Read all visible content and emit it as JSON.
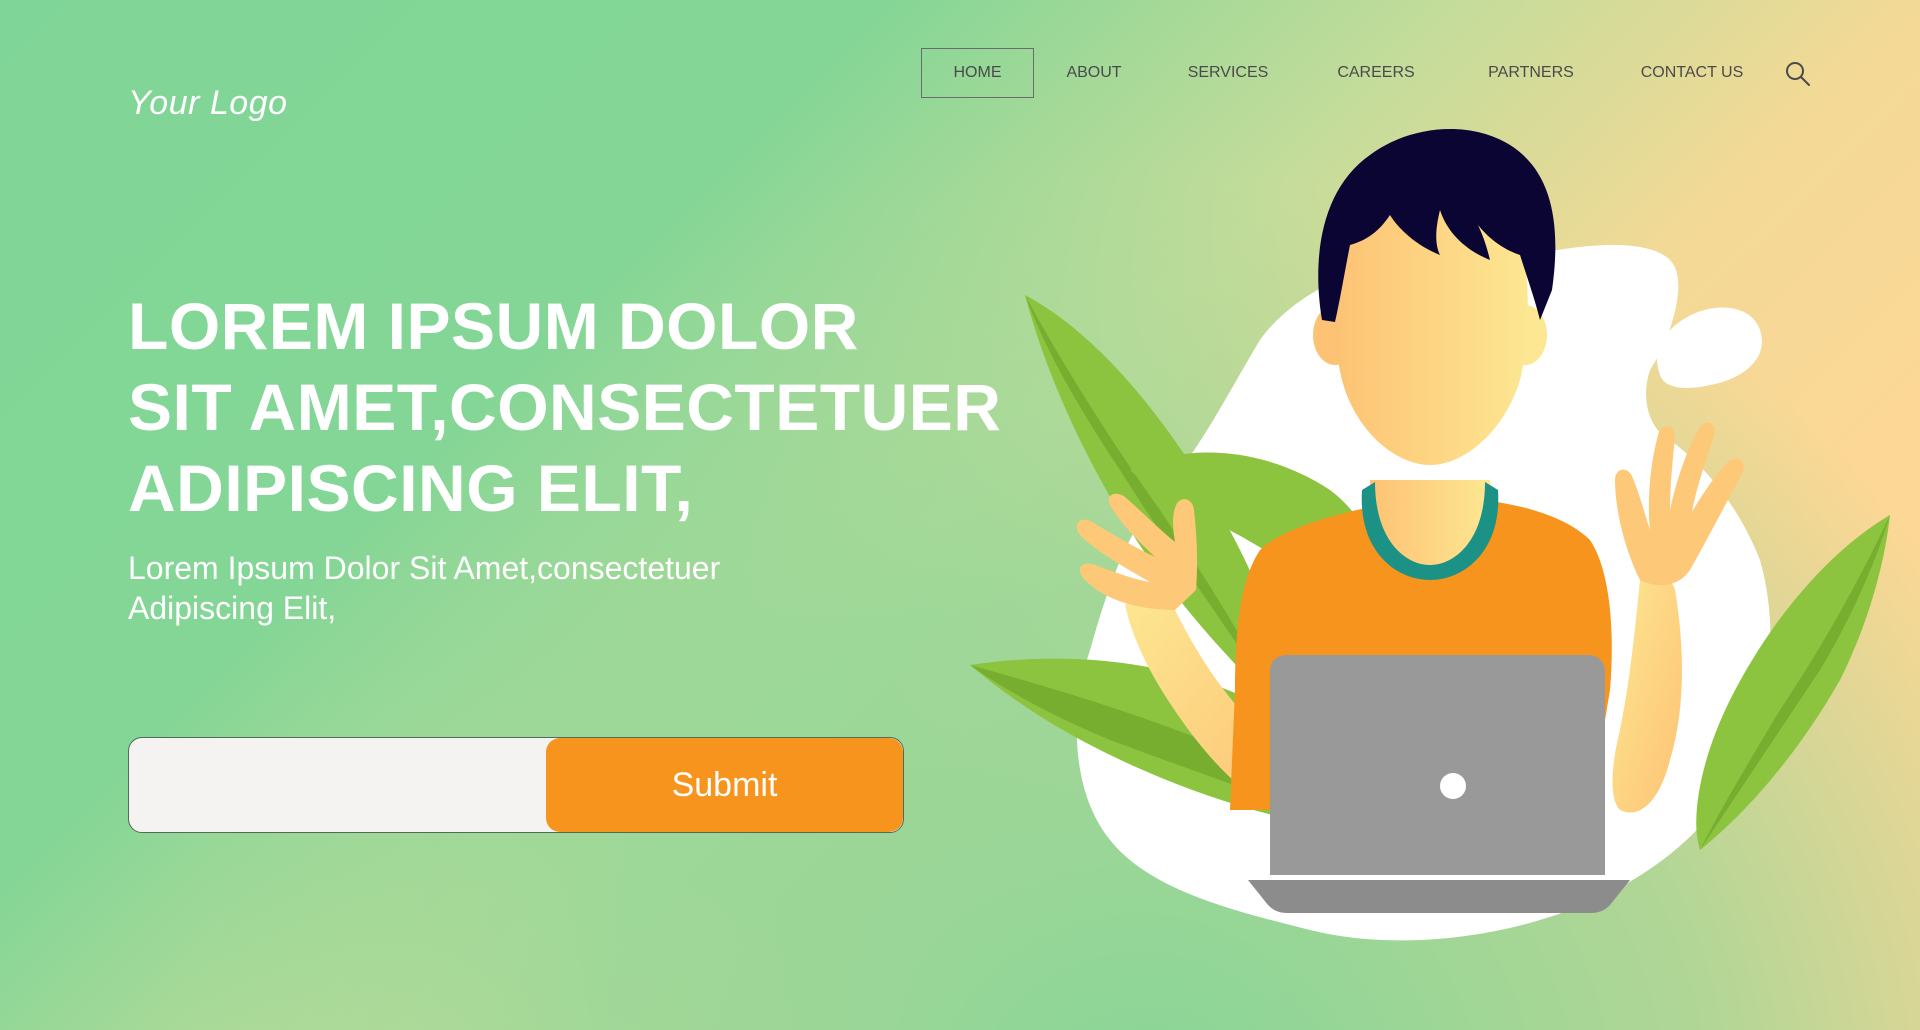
{
  "logo": {
    "text": "Your Logo"
  },
  "nav": {
    "items": [
      {
        "label": "HOME",
        "active": true
      },
      {
        "label": "ABOUT"
      },
      {
        "label": "SERVICES"
      },
      {
        "label": "CAREERS"
      },
      {
        "label": "PARTNERS"
      },
      {
        "label": "CONTACT US"
      }
    ],
    "search_icon": "search-icon"
  },
  "hero": {
    "title_lines": [
      "LOREM IPSUM DOLOR",
      "SIT AMET,CONSECTETUER",
      "ADIPISCING ELIT,"
    ],
    "subtitle_lines": [
      "Lorem Ipsum Dolor Sit Amet,consectetuer",
      "Adipiscing Elit,"
    ]
  },
  "form": {
    "input_value": "",
    "input_placeholder": "",
    "submit_label": "Submit"
  },
  "colors": {
    "accent": "#f7941d",
    "background_green": "#7fd597",
    "background_peach": "#fdd795",
    "leaf_green": "#8cc43f",
    "hair": "#0b0534",
    "laptop": "#999999"
  }
}
